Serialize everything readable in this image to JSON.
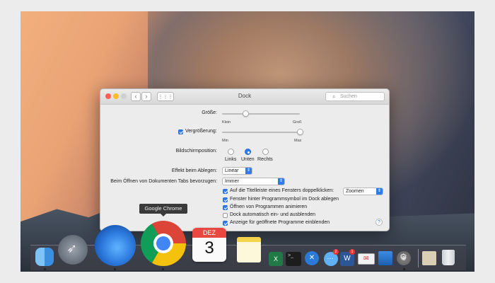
{
  "window": {
    "title": "Dock",
    "search_placeholder": "Suchen"
  },
  "size": {
    "label": "Größe:",
    "min_label": "Klein",
    "max_label": "Groß",
    "value_fraction": 0.3
  },
  "magnification": {
    "label": "Vergrößerung:",
    "checked": true,
    "min_label": "Min",
    "max_label": "Max",
    "value_fraction": 1.0
  },
  "position": {
    "label": "Bildschirmposition:",
    "options": [
      "Links",
      "Unten",
      "Rechts"
    ],
    "selected": "Unten"
  },
  "minimize_effect": {
    "label": "Effekt beim Ablegen:",
    "value": "Linear"
  },
  "prefer_tabs": {
    "label": "Beim Öffnen von Dokumenten Tabs bevorzugen:",
    "value": "Immer"
  },
  "titlebar_doubleclick": {
    "label": "Auf die Titelleiste eines Fensters doppelklicken:",
    "checked": true,
    "value": "Zoomen"
  },
  "checkboxes": [
    {
      "label": "Fenster hinter Programmsymbol im Dock ablegen",
      "checked": true
    },
    {
      "label": "Öffnen von Programmen animieren",
      "checked": true
    },
    {
      "label": "Dock automatisch ein- und ausblenden",
      "checked": false
    },
    {
      "label": "Anzeige für geöffnete Programme einblenden",
      "checked": true
    }
  ],
  "help_label": "?",
  "tooltip": "Google Chrome",
  "calendar": {
    "month": "DEZ",
    "day": "3"
  },
  "dock": {
    "icons": [
      "finder-icon",
      "launchpad-icon",
      "firefox-icon",
      "chrome-icon",
      "calendar-icon",
      "notes-icon",
      "excel-icon",
      "terminal-icon",
      "xcode-icon",
      "messages-icon",
      "word-icon",
      "mail-icon",
      "preview-icon",
      "system-preferences-icon",
      "downloads-icon",
      "trash-icon"
    ],
    "messages_badge": "2",
    "word_badge": "1"
  },
  "colors": {
    "accent": "#2f7bea",
    "tooltip_bg": "#3a3a3a"
  }
}
